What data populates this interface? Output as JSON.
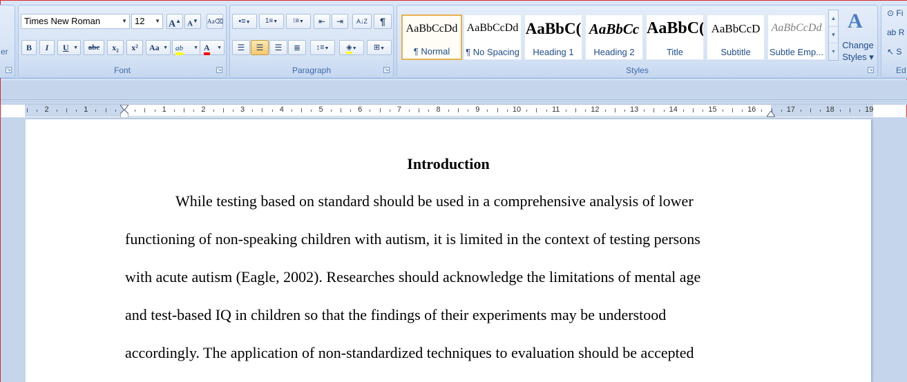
{
  "ribbon": {
    "left_cut_label": "er",
    "font_group": {
      "label": "Font",
      "font_name": "Times New Roman",
      "font_size": "12",
      "grow_font": "A",
      "shrink_font": "A",
      "bold": "B",
      "italic": "I",
      "underline": "U",
      "strikethrough": "abc",
      "subscript": "x₂",
      "superscript": "x²",
      "change_case": "Aa",
      "highlight": "ab",
      "font_color": "A"
    },
    "paragraph_group": {
      "label": "Paragraph",
      "sort": "A↓Z",
      "pilcrow": "¶"
    },
    "styles_group": {
      "label": "Styles",
      "tiles": [
        {
          "preview": "AaBbCcDd",
          "name": "¶ Normal"
        },
        {
          "preview": "AaBbCcDd",
          "name": "¶ No Spacing"
        },
        {
          "preview": "AaBbC(",
          "name": "Heading 1"
        },
        {
          "preview": "AaBbCc",
          "name": "Heading 2"
        },
        {
          "preview": "AaBbC(",
          "name": "Title"
        },
        {
          "preview": "AaBbCcD",
          "name": "Subtitle"
        },
        {
          "preview": "AaBbCcDd",
          "name": "Subtle Emp..."
        }
      ],
      "change_styles_line1": "Change",
      "change_styles_line2": "Styles ▾"
    },
    "editing_group": {
      "label": "Ed",
      "find": "Fi",
      "replace": "R",
      "select": "S"
    }
  },
  "ruler": {
    "left_numbers": [
      "2",
      "1"
    ],
    "numbers": [
      "1",
      "2",
      "3",
      "4",
      "5",
      "6",
      "7",
      "8",
      "9",
      "10",
      "11",
      "12",
      "13",
      "14",
      "15",
      "16",
      "17",
      "18",
      "19"
    ]
  },
  "document": {
    "heading": "Introduction",
    "lines": [
      "While testing based on standard should be used in a comprehensive analysis of lower",
      "functioning of non-speaking children with autism, it is limited in the context of testing persons",
      "with acute autism (Eagle, 2002). Researches should acknowledge the limitations of mental age",
      "and test-based IQ in children so that the findings of their experiments may be understood",
      "accordingly. The application of non-standardized techniques to evaluation should be accepted"
    ]
  },
  "colors": {
    "ribbon_bg": "#cfdef2",
    "accent_border": "#d8262e",
    "highlight_yellow": "#ffff00",
    "font_color_red": "#ff0000",
    "selected_style_border": "#e8b04c"
  }
}
